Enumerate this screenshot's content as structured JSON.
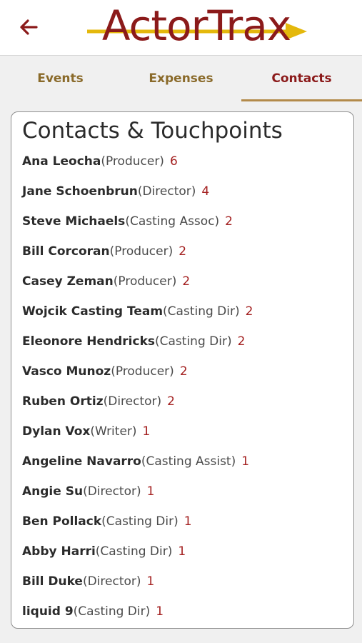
{
  "header": {
    "back_icon": "back-arrow-icon",
    "logo_text": "ActorTrax",
    "colors": {
      "brand": "#8b1a1a",
      "arrow": "#e4b80c"
    }
  },
  "tabs": [
    {
      "label": "Events"
    },
    {
      "label": "Expenses"
    },
    {
      "label": "Contacts",
      "active": true
    }
  ],
  "contacts": {
    "title": "Contacts & Touchpoints",
    "items": [
      {
        "name": "Ana Leocha",
        "role": "(Producer)",
        "count": "6"
      },
      {
        "name": "Jane Schoenbrun",
        "role": "(Director)",
        "count": "4"
      },
      {
        "name": "Steve Michaels",
        "role": "(Casting Assoc)",
        "count": "2"
      },
      {
        "name": "Bill Corcoran",
        "role": "(Producer)",
        "count": "2"
      },
      {
        "name": "Casey Zeman",
        "role": "(Producer)",
        "count": "2"
      },
      {
        "name": "Wojcik Casting Team",
        "role": "(Casting Dir)",
        "count": "2"
      },
      {
        "name": "Eleonore Hendricks",
        "role": "(Casting Dir)",
        "count": "2"
      },
      {
        "name": "Vasco Munoz",
        "role": "(Producer)",
        "count": "2"
      },
      {
        "name": "Ruben Ortiz",
        "role": "(Director)",
        "count": "2"
      },
      {
        "name": "Dylan Vox",
        "role": "(Writer)",
        "count": "1"
      },
      {
        "name": "Angeline Navarro",
        "role": "(Casting Assist)",
        "count": "1"
      },
      {
        "name": "Angie Su",
        "role": "(Director)",
        "count": "1"
      },
      {
        "name": "Ben Pollack",
        "role": "(Casting Dir)",
        "count": "1"
      },
      {
        "name": "Abby Harri",
        "role": "(Casting Dir)",
        "count": "1"
      },
      {
        "name": "Bill Duke",
        "role": "(Director)",
        "count": "1"
      },
      {
        "name": "liquid 9",
        "role": "(Casting Dir)",
        "count": "1"
      }
    ]
  }
}
